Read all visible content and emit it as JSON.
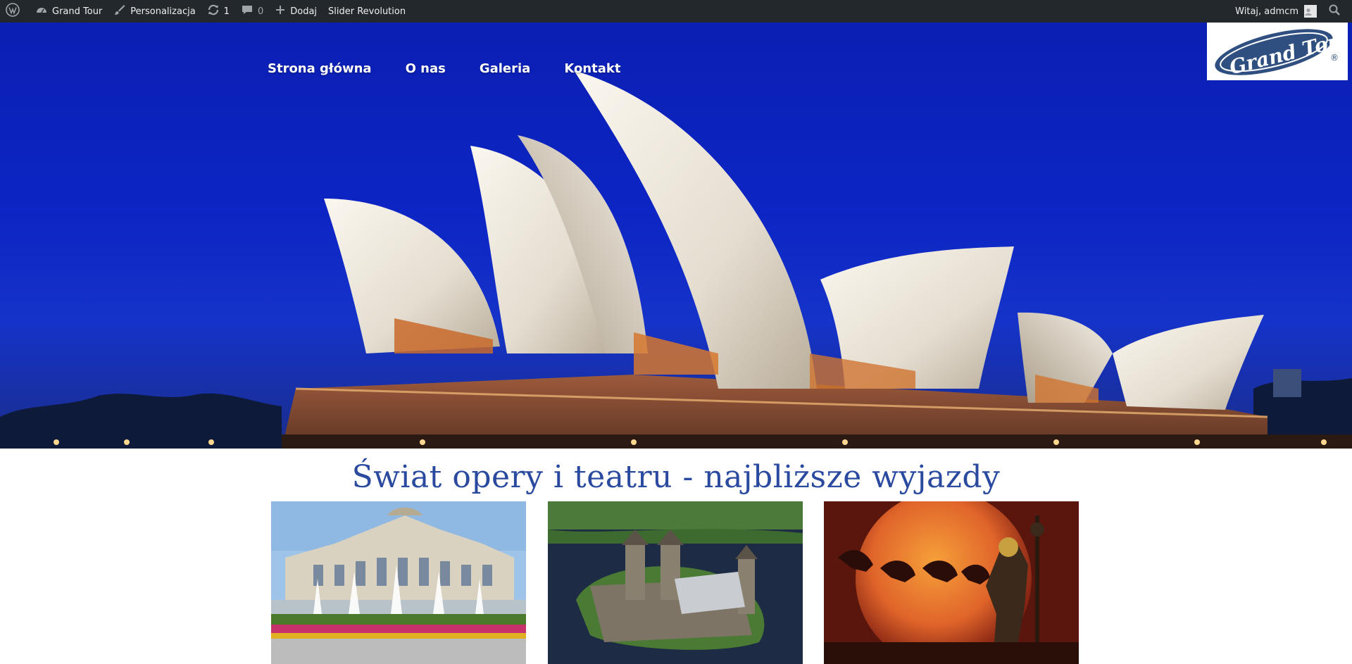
{
  "admin_bar": {
    "site_name": "Grand Tour",
    "customize_label": "Personalizacja",
    "updates_count": "1",
    "comments_count": "0",
    "new_label": "Dodaj",
    "plugin_label": "Slider Revolution",
    "greeting": "Witaj, admcm"
  },
  "nav": {
    "items": [
      {
        "label": "Strona główna"
      },
      {
        "label": "O nas"
      },
      {
        "label": "Galeria"
      },
      {
        "label": "Kontakt"
      }
    ]
  },
  "logo": {
    "text": "Grand Tour",
    "mark": "®"
  },
  "section": {
    "title": "Świat opery i teatru - najbliższe wyjazdy"
  },
  "colors": {
    "admin_bar_bg": "#23282d",
    "title_color": "#2a4aa0",
    "sky_blue": "#0d25c4"
  },
  "icons": {
    "wordpress": "wordpress-icon",
    "dashboard": "dashboard-icon",
    "brush": "brush-icon",
    "updates": "updates-icon",
    "comments": "comment-icon",
    "add": "plus-icon",
    "search": "search-icon"
  }
}
